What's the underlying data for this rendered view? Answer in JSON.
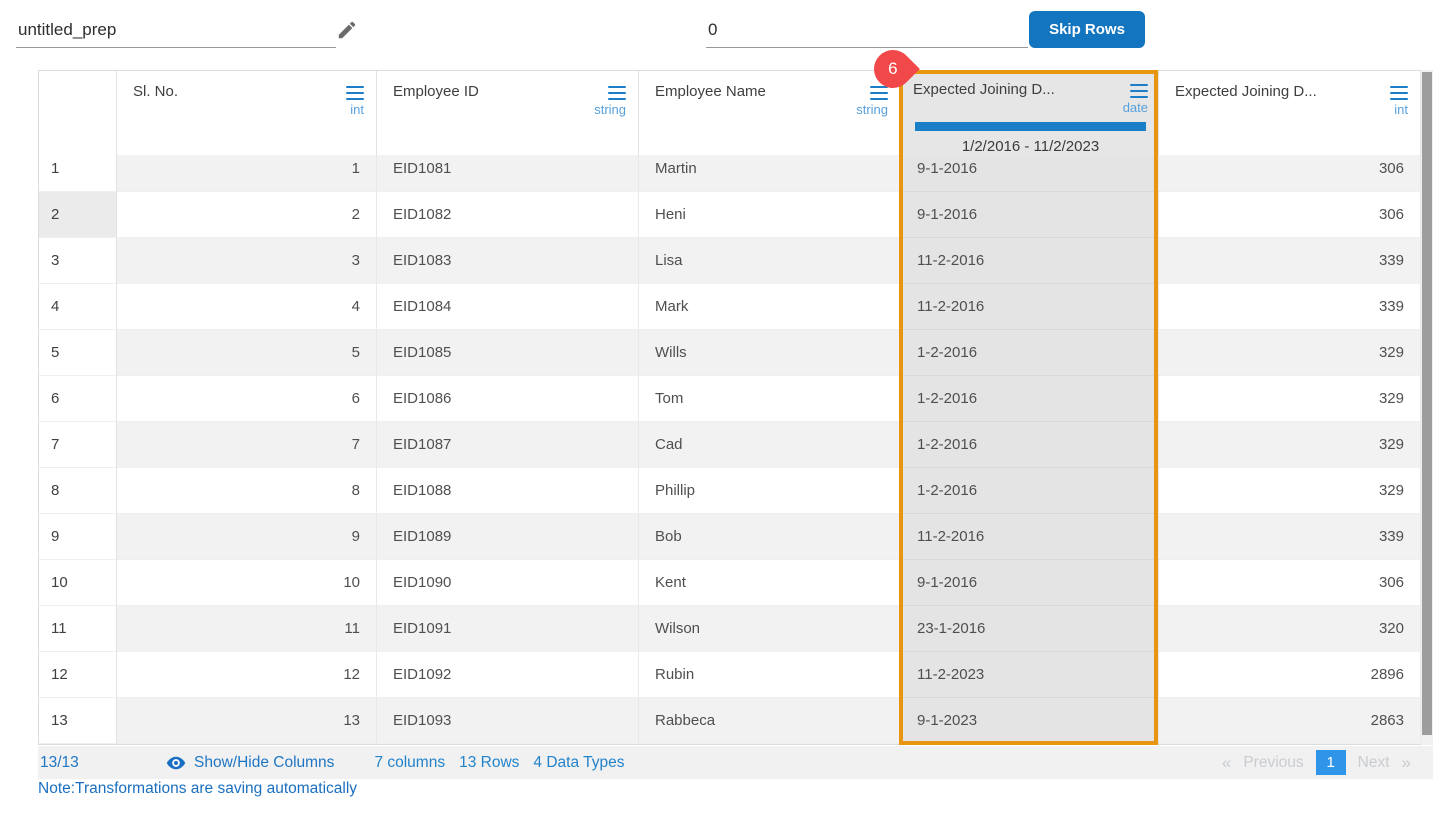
{
  "top_bar": {
    "prep_name": "untitled_prep",
    "skip_rows_value": "0",
    "skip_rows_button": "Skip Rows"
  },
  "selected_column_badge": "6",
  "table": {
    "highlighted_row": 2,
    "columns": [
      {
        "label": "Sl. No.",
        "type": "int"
      },
      {
        "label": "Employee ID",
        "type": "string"
      },
      {
        "label": "Employee Name",
        "type": "string"
      },
      {
        "label": "Expected Joining D...",
        "type": "date",
        "range": "1/2/2016 - 11/2/2023",
        "selected": true
      },
      {
        "label": "Expected Joining D...",
        "type": "int"
      }
    ],
    "rows": [
      {
        "num": "1",
        "sl_no": "1",
        "employee_id": "EID1081",
        "employee_name": "Martin",
        "joining_date": "9-1-2016",
        "joining_int": "306"
      },
      {
        "num": "2",
        "sl_no": "2",
        "employee_id": "EID1082",
        "employee_name": "Heni",
        "joining_date": "9-1-2016",
        "joining_int": "306"
      },
      {
        "num": "3",
        "sl_no": "3",
        "employee_id": "EID1083",
        "employee_name": "Lisa",
        "joining_date": "11-2-2016",
        "joining_int": "339"
      },
      {
        "num": "4",
        "sl_no": "4",
        "employee_id": "EID1084",
        "employee_name": "Mark",
        "joining_date": "11-2-2016",
        "joining_int": "339"
      },
      {
        "num": "5",
        "sl_no": "5",
        "employee_id": "EID1085",
        "employee_name": "Wills",
        "joining_date": "1-2-2016",
        "joining_int": "329"
      },
      {
        "num": "6",
        "sl_no": "6",
        "employee_id": "EID1086",
        "employee_name": "Tom",
        "joining_date": "1-2-2016",
        "joining_int": "329"
      },
      {
        "num": "7",
        "sl_no": "7",
        "employee_id": "EID1087",
        "employee_name": "Cad",
        "joining_date": "1-2-2016",
        "joining_int": "329"
      },
      {
        "num": "8",
        "sl_no": "8",
        "employee_id": "EID1088",
        "employee_name": "Phillip",
        "joining_date": "1-2-2016",
        "joining_int": "329"
      },
      {
        "num": "9",
        "sl_no": "9",
        "employee_id": "EID1089",
        "employee_name": "Bob",
        "joining_date": "11-2-2016",
        "joining_int": "339"
      },
      {
        "num": "10",
        "sl_no": "10",
        "employee_id": "EID1090",
        "employee_name": "Kent",
        "joining_date": "9-1-2016",
        "joining_int": "306"
      },
      {
        "num": "11",
        "sl_no": "11",
        "employee_id": "EID1091",
        "employee_name": "Wilson",
        "joining_date": "23-1-2016",
        "joining_int": "320"
      },
      {
        "num": "12",
        "sl_no": "12",
        "employee_id": "EID1092",
        "employee_name": "Rubin",
        "joining_date": "11-2-2023",
        "joining_int": "2896"
      },
      {
        "num": "13",
        "sl_no": "13",
        "employee_id": "EID1093",
        "employee_name": "Rabbeca",
        "joining_date": "9-1-2023",
        "joining_int": "2863"
      }
    ]
  },
  "footer": {
    "count": "13/13",
    "show_hide_label": "Show/Hide Columns",
    "columns_summary": "7 columns",
    "rows_summary": "13 Rows",
    "types_summary": "4 Data Types",
    "prev_arrow": "«",
    "previous_label": "Previous",
    "current_page": "1",
    "next_label": "Next",
    "next_arrow": "»"
  },
  "note": "Note:Transformations are saving automatically",
  "colors": {
    "accent_blue": "#1b7fc7",
    "type_label_blue": "#58a0dc",
    "button_blue": "#1375bf",
    "pager_active_blue": "#2e95e8",
    "footer_link_blue": "#2076c4",
    "selection_orange": "#e8950f",
    "badge_red": "#f14949",
    "stripe_gray": "#f2f2f2",
    "selected_cell_gray": "#e4e4e4"
  }
}
